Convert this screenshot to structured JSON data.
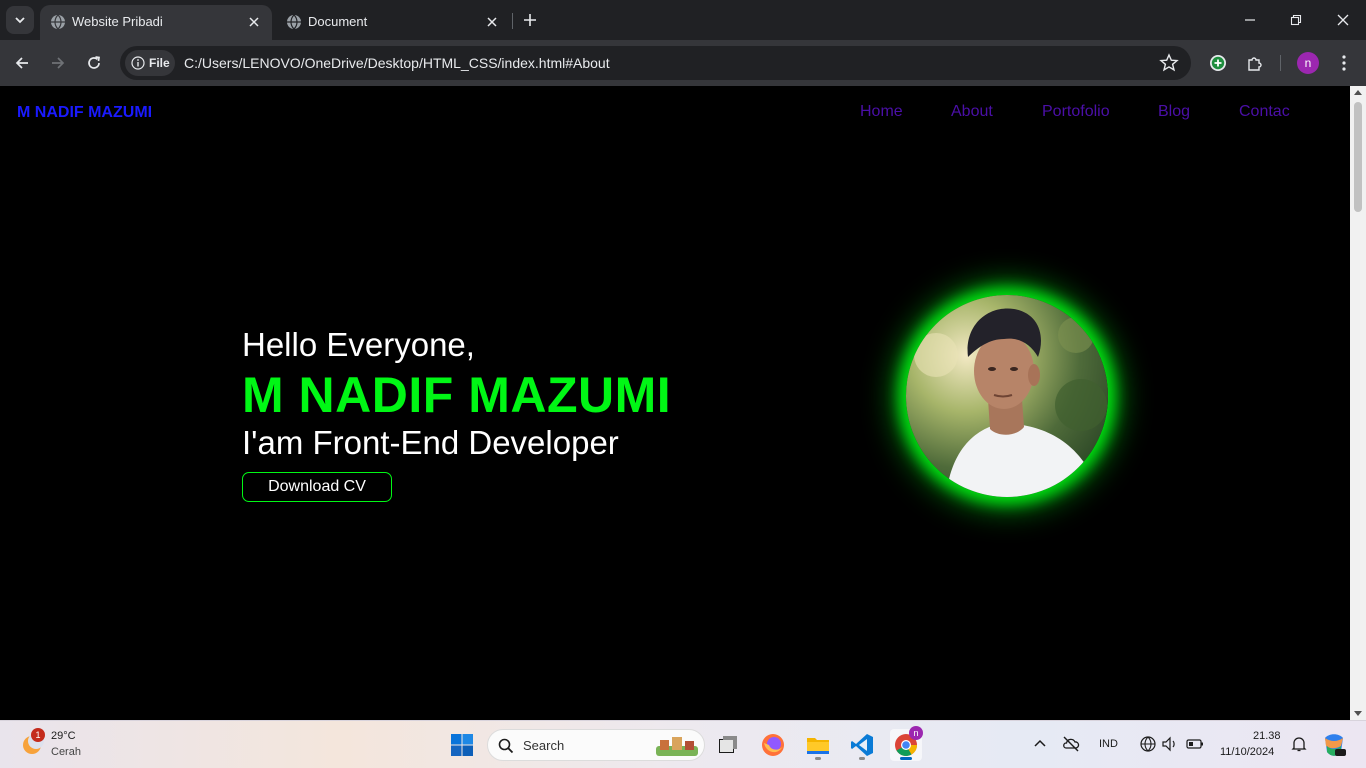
{
  "browser": {
    "tabs": [
      {
        "title": "Website Pribadi",
        "active": true
      },
      {
        "title": "Document",
        "active": false
      }
    ],
    "site_chip": "File",
    "url": "C:/Users/LENOVO/OneDrive/Desktop/HTML_CSS/index.html#About",
    "profile_initial": "n"
  },
  "page": {
    "brand": "M NADIF MAZUMI",
    "nav": [
      "Home",
      "About",
      "Portofolio",
      "Blog",
      "Contac"
    ],
    "hero": {
      "greeting": "Hello Everyone,",
      "name": "M NADIF MAZUMI",
      "role": "I'am Front-End Developer",
      "cta": "Download CV"
    },
    "colors": {
      "background": "#000000",
      "brand": "#1a1aff",
      "nav": "#4b0fa8",
      "accent": "#00f715"
    }
  },
  "taskbar": {
    "weather_temp": "29°C",
    "weather_desc": "Cerah",
    "weather_badge": "1",
    "search_label": "Search",
    "language": "IND",
    "time": "21.38",
    "date": "11/10/2024",
    "chrome_badge": "n"
  }
}
